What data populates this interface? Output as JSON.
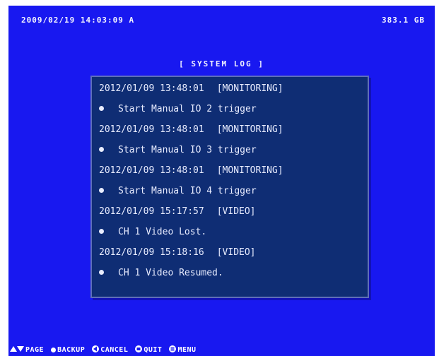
{
  "status_bar": {
    "datetime": "2009/02/19 14:03:09  A",
    "disk": "383.1 GB"
  },
  "title": "[ SYSTEM LOG ]",
  "log_entries": [
    {
      "timestamp": "2012/01/09 13:48:01",
      "category": "[MONITORING]",
      "message": "Start Manual IO 2 trigger"
    },
    {
      "timestamp": "2012/01/09 13:48:01",
      "category": "[MONITORING]",
      "message": "Start Manual IO 3 trigger"
    },
    {
      "timestamp": "2012/01/09 13:48:01",
      "category": "[MONITORING]",
      "message": "Start Manual IO 4 trigger"
    },
    {
      "timestamp": "2012/01/09 15:17:57",
      "category": "[VIDEO]",
      "message": "CH 1 Video Lost."
    },
    {
      "timestamp": "2012/01/09 15:18:16",
      "category": "[VIDEO]",
      "message": "CH 1 Video Resumed."
    }
  ],
  "footer": {
    "page_label": "PAGE",
    "backup_label": "BACKUP",
    "cancel_label": "CANCEL",
    "quit_label": "QUIT",
    "menu_label": "MENU"
  },
  "icons": {
    "page": "up-down-arrows-icon",
    "backup": "dot-icon",
    "cancel": "left-arrow-icon",
    "quit": "quit-icon",
    "menu": "menu-icon"
  },
  "colors": {
    "background": "#1818f0",
    "panel": "#0f2d74",
    "text": "#e8ecff"
  }
}
